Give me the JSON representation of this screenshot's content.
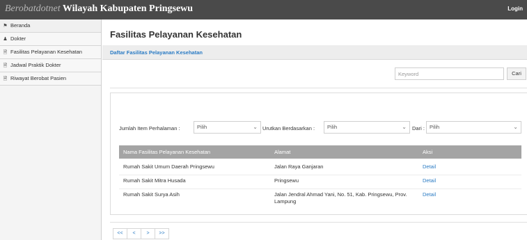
{
  "header": {
    "brand_italic": "Berobatdotnet",
    "brand_bold": "Wilayah Kabupaten Pringsewu",
    "login_label": "Login"
  },
  "sidebar": {
    "items": [
      {
        "label": "Beranda",
        "icon": "home-icon"
      },
      {
        "label": "Dokter",
        "icon": "user-icon"
      },
      {
        "label": "Fasilitas Pelayanan Kesehatan",
        "icon": "document-icon"
      },
      {
        "label": "Jadwal Praktik Dokter",
        "icon": "document-icon"
      },
      {
        "label": "Riwayat Berobat Pasien",
        "icon": "document-icon"
      }
    ]
  },
  "main": {
    "title": "Fasilitas Pelayanan Kesehatan",
    "breadcrumb": "Daftar Fasilitas Pelayanan Kesehatan",
    "search": {
      "placeholder": "Keyword",
      "value": "",
      "button_label": "Cari"
    },
    "filters": {
      "per_page_label": "Jumlah Item Perhalaman :",
      "per_page_value": "Pilih",
      "sort_label": "Urutkan Berdasarkan :",
      "sort_value": "Pilih",
      "order_label": "Dari :",
      "order_value": "Pilih"
    },
    "table": {
      "columns": [
        "Nama Fasilitas Pelayanan Kesehatan",
        "Alamat",
        "Aksi"
      ],
      "rows": [
        {
          "name": "Rumah Sakit Umum Daerah Pringsewu",
          "address": "Jalan Raya Ganjaran",
          "action": "Detail"
        },
        {
          "name": "Rumah Sakit Mitra Husada",
          "address": "Pringsewu",
          "action": "Detail"
        },
        {
          "name": "Rumah Sakit Surya Asih",
          "address": "Jalan Jendral Ahmad Yani, No. 51, Kab. Pringsewu, Prov. Lampung",
          "action": "Detail"
        }
      ]
    },
    "pagination": [
      "<<",
      "<",
      ">",
      ">>"
    ]
  },
  "colors": {
    "topbar": "#4a4a4a",
    "link": "#2a7bc4",
    "table_header": "#a4a4a4"
  }
}
